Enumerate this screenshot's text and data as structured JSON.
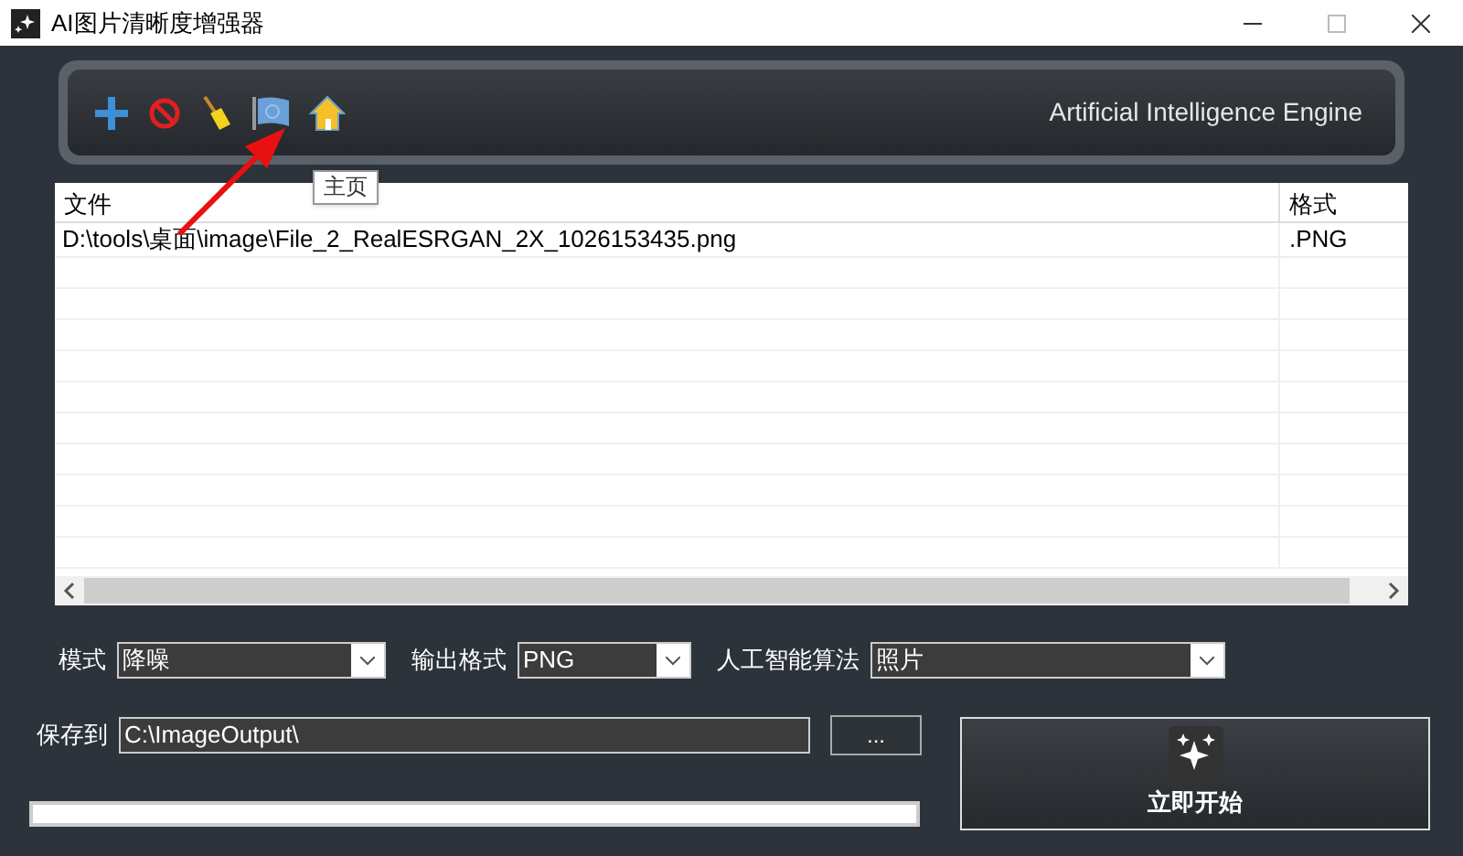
{
  "window": {
    "title": "AI图片清晰度增强器"
  },
  "toolbar": {
    "tooltip": "主页",
    "engine_label": "Artificial Intelligence Engine"
  },
  "table": {
    "columns": [
      "文件",
      "格式"
    ],
    "rows": [
      {
        "file": "D:\\tools\\桌面\\image\\File_2_RealESRGAN_2X_1026153435.png",
        "format": ".PNG"
      }
    ]
  },
  "options": [
    {
      "label": "模式",
      "value": "降噪"
    },
    {
      "label": "输出格式",
      "value": "PNG"
    },
    {
      "label": "人工智能算法",
      "value": "照片"
    }
  ],
  "save": {
    "label": "保存到",
    "value": "C:\\ImageOutput\\",
    "browse": "..."
  },
  "start_button": {
    "label": "立即开始"
  }
}
